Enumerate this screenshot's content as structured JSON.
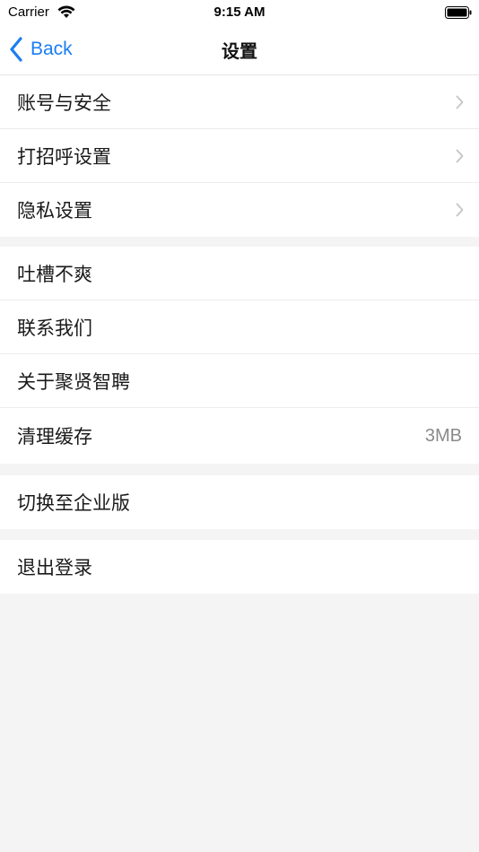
{
  "status_bar": {
    "carrier": "Carrier",
    "time": "9:15 AM"
  },
  "nav": {
    "back_label": "Back",
    "title": "设置"
  },
  "groups": [
    {
      "items": [
        {
          "label": "账号与安全",
          "chevron": true
        },
        {
          "label": "打招呼设置",
          "chevron": true
        },
        {
          "label": "隐私设置",
          "chevron": true
        }
      ]
    },
    {
      "items": [
        {
          "label": "吐槽不爽"
        },
        {
          "label": "联系我们"
        },
        {
          "label": "关于聚贤智聘"
        },
        {
          "label": "清理缓存",
          "value": "3MB"
        }
      ]
    },
    {
      "items": [
        {
          "label": "切换至企业版"
        }
      ]
    },
    {
      "items": [
        {
          "label": "退出登录"
        }
      ]
    }
  ],
  "colors": {
    "accent": "#1a7ef2",
    "background": "#f4f4f4",
    "cell": "#ffffff",
    "value_text": "#8a8a8a",
    "chevron": "#c4c4c9"
  },
  "icons": [
    "wifi-icon",
    "battery-icon",
    "chevron-left-icon",
    "chevron-right-icon"
  ]
}
